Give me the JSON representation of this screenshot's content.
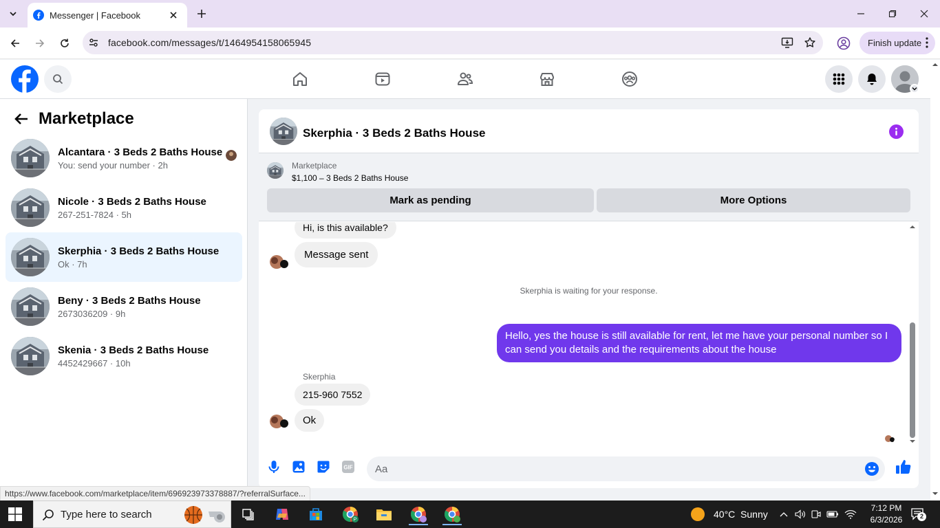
{
  "browser": {
    "tab_title": "Messenger | Facebook",
    "url": "facebook.com/messages/t/1464954158065945",
    "finish_update": "Finish update",
    "status_url": "https://www.facebook.com/marketplace/item/696923973378887/?referralSurface..."
  },
  "icons": [
    "facebook-logo",
    "search-icon",
    "home-icon",
    "video-icon",
    "friends-icon",
    "marketplace-icon",
    "groups-icon",
    "menu-grid-icon",
    "bell-icon",
    "info-icon",
    "mic-icon",
    "image-icon",
    "sticker-icon",
    "gif-icon",
    "emoji-icon",
    "like-icon"
  ],
  "colors": {
    "accent": "#7038ec",
    "fb_blue": "#0866ff",
    "info_purple": "#9b2df0",
    "active_conv": "#ebf5ff"
  },
  "sidebar": {
    "title": "Marketplace",
    "conversations": [
      {
        "name": "Alcantara · 3 Beds 2 Baths House",
        "sub": "You: send your number · 2h",
        "active": false
      },
      {
        "name": "Nicole · 3 Beds 2 Baths House",
        "sub": "267-251-7824 · 5h",
        "active": false
      },
      {
        "name": "Skerphia · 3 Beds 2 Baths House",
        "sub": "Ok · 7h",
        "active": true
      },
      {
        "name": "Beny · 3 Beds 2 Baths House",
        "sub": "2673036209 · 9h",
        "active": false
      },
      {
        "name": "Skenia · 3 Beds 2 Baths House",
        "sub": "4452429667 · 10h",
        "active": false
      }
    ]
  },
  "chat": {
    "title": "Skerphia · 3 Beds 2 Baths House",
    "marketplace_label": "Marketplace",
    "listing": "$1,100 – 3 Beds 2 Baths House",
    "mark_pending": "Mark as pending",
    "more_options": "More Options",
    "messages": {
      "m1": "Hi, is this available?",
      "m2": "Message sent",
      "system": "Skerphia is waiting for your response.",
      "reply": "Hello, yes the house is still available for rent, let me have your personal number so I can send you details and the requirements about the house",
      "sender": "Skerphia",
      "m3": "215-960 7552",
      "m4": "Ok"
    },
    "composer_placeholder": "Aa"
  },
  "taskbar": {
    "search_placeholder": "Type here to search",
    "weather": "40°C  Sunny",
    "time": "7:12 PM",
    "date": "6/3/2026",
    "notifications": "2"
  }
}
